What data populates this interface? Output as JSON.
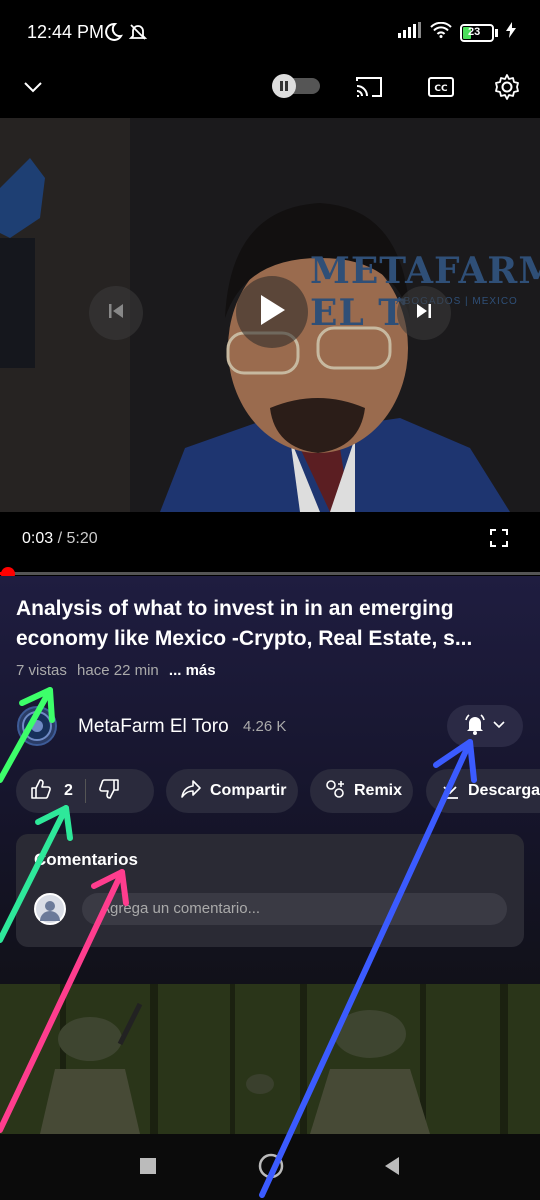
{
  "status_bar": {
    "time": "12:44 PM",
    "battery": "23"
  },
  "player": {
    "current_time": "0:03",
    "separator": " / ",
    "duration": "5:20",
    "progress": 0.0094,
    "video_brand": "METAFARM EL T",
    "video_brand_sub": "ABOGADOS | MEXICO"
  },
  "video": {
    "title": "Analysis of what to invest in in an emerging economy like Mexico -Crypto, Real Estate, s...",
    "views": "7 vistas",
    "age": "hace 22 min",
    "more": "... más"
  },
  "channel": {
    "name": "MetaFarm El Toro",
    "subscribers": "4.26 K"
  },
  "actions": {
    "likes": "2",
    "share": "Compartir",
    "remix": "Remix",
    "download": "Descarga"
  },
  "comments": {
    "title": "Comentarios",
    "placeholder": "Agrega un comentario..."
  },
  "colors": {
    "accent_red": "#ff0000",
    "arrow_green": "#3dff6a",
    "arrow_mint": "#2ee89a",
    "arrow_pink": "#ff3d8e",
    "arrow_blue": "#3b5bff"
  },
  "icons": [
    "chevron-down-icon",
    "pause-toggle-icon",
    "cast-icon",
    "captions-icon",
    "gear-icon",
    "previous-icon",
    "play-icon",
    "next-icon",
    "fullscreen-icon",
    "bell-icon",
    "like-icon",
    "dislike-icon",
    "share-icon",
    "remix-icon",
    "download-icon",
    "nav-square-icon",
    "nav-home-icon",
    "nav-back-icon"
  ]
}
